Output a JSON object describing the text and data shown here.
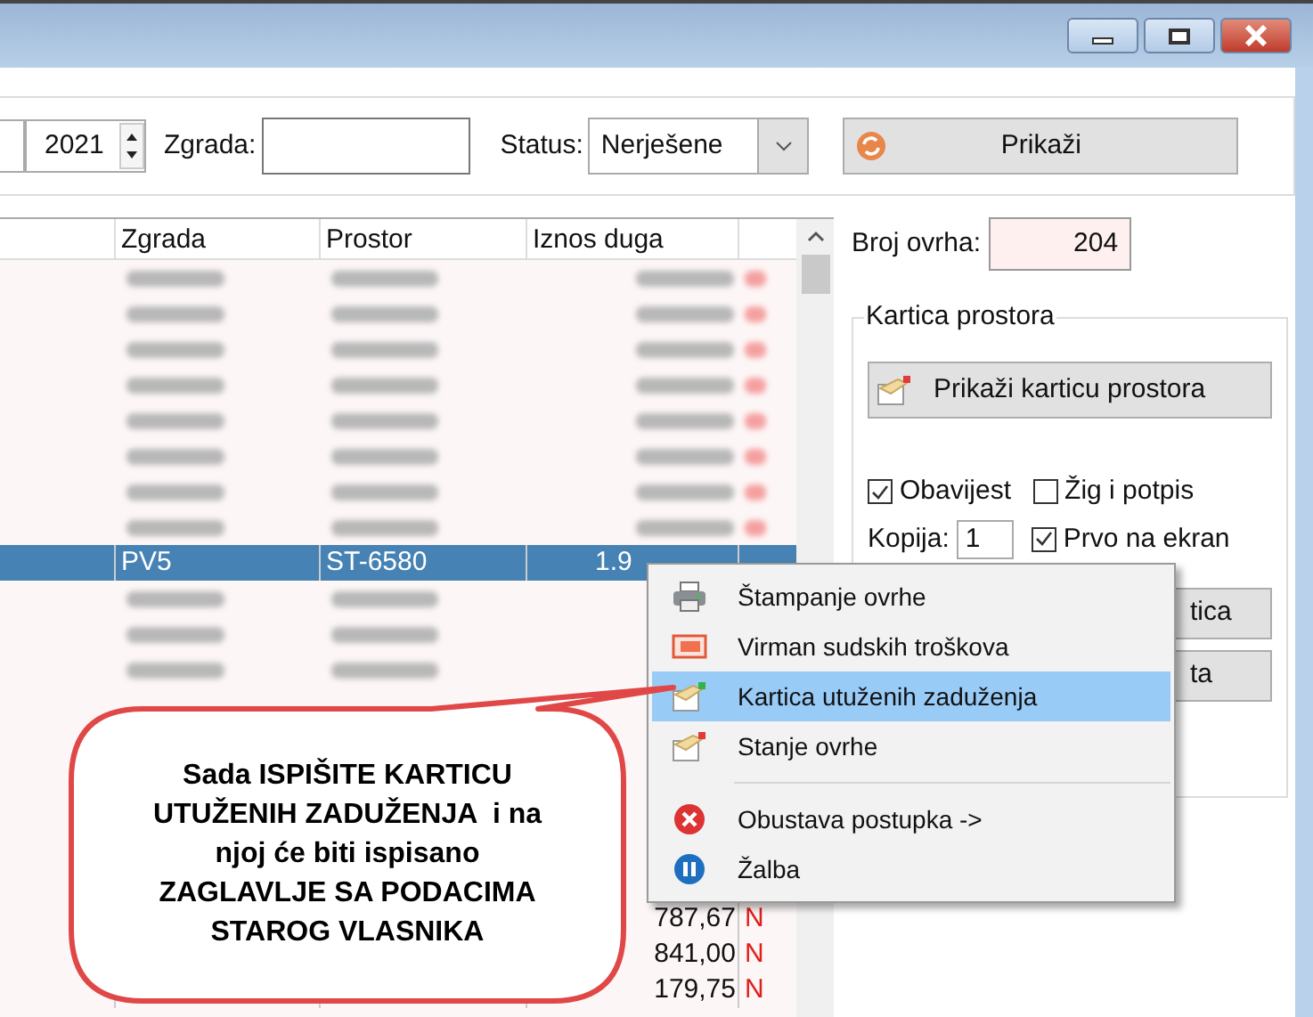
{
  "toolbar": {
    "year": "2021",
    "zgrada_label": "Zgrada:",
    "status_label": "Status:",
    "status_value": "Nerješene",
    "show_button": "Prikaži"
  },
  "table": {
    "columns": [
      "Zgrada",
      "Prostor",
      "Iznos duga"
    ],
    "rows": [
      {
        "kind": "blurred"
      },
      {
        "kind": "blurred"
      },
      {
        "kind": "blurred"
      },
      {
        "kind": "blurred"
      },
      {
        "kind": "blurred"
      },
      {
        "kind": "blurred"
      },
      {
        "kind": "blurred"
      },
      {
        "kind": "blurred"
      },
      {
        "kind": "visible",
        "selected": true,
        "zgrada": "PV5",
        "prostor": "ST-6580",
        "iznos": "1.9"
      },
      {
        "kind": "blurred"
      },
      {
        "kind": "blurred"
      },
      {
        "kind": "blurred"
      },
      {
        "kind": "blurred"
      },
      {
        "kind": "blurred"
      },
      {
        "kind": "blurred"
      },
      {
        "kind": "blurred"
      },
      {
        "kind": "blurred"
      },
      {
        "kind": "blurred"
      },
      {
        "kind": "visible",
        "selected": false,
        "zgrada": "",
        "prostor": "",
        "iznos": "787,67",
        "flag": "N"
      },
      {
        "kind": "visible",
        "selected": false,
        "zgrada": "",
        "prostor": "",
        "iznos": "841,00",
        "flag": "N"
      },
      {
        "kind": "visible",
        "selected": false,
        "zgrada": "",
        "prostor": "",
        "iznos": "179,75",
        "flag": "N"
      }
    ]
  },
  "side": {
    "count_label": "Broj ovrha:",
    "count_value": "204",
    "group_title": "Kartica prostora",
    "card_button": "Prikaži karticu prostora",
    "checks": [
      {
        "label": "Obavijest",
        "checked": true
      },
      {
        "label": "Žig i potpis",
        "checked": false
      }
    ],
    "copies_label": "Kopija:",
    "copies_value": "1",
    "screen_check": {
      "label": "Prvo na ekran",
      "checked": true
    },
    "buttons": [
      "tica",
      "ta"
    ]
  },
  "context_menu": [
    {
      "kind": "item",
      "label": "Štampanje ovrhe",
      "selected": false
    },
    {
      "kind": "item",
      "label": "Virman sudskih troškova",
      "selected": false
    },
    {
      "kind": "item",
      "label": "Kartica utuženih zaduženja",
      "selected": true
    },
    {
      "kind": "item",
      "label": "Stanje ovrhe",
      "selected": false
    },
    {
      "kind": "separator"
    },
    {
      "kind": "item",
      "label": "Obustava postupka ->",
      "selected": false
    },
    {
      "kind": "item",
      "label": "Žalba",
      "selected": false
    }
  ],
  "callout": {
    "text": "Sada ISPIŠITE KARTICU\nUTUŽENIH ZADUŽENJA  i na\nnjoj će biti ispisano\nZAGLAVLJE SA PODACIMA\nSTAROG VLASNIKA"
  }
}
